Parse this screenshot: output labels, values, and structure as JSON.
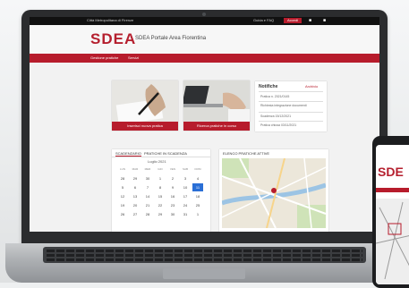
{
  "site": {
    "topbar_left": "Città Metropolitana di Firenze",
    "topbar_link": "Guida e FAQ",
    "topbar_button": "Accedi",
    "logo": "SDEA",
    "logo_subtitle": "SDEA Portale Area Fiorentina",
    "nav": [
      "Gestione pratiche",
      "Servizi"
    ]
  },
  "cards": [
    {
      "caption": "Inserisci nuova pratica"
    },
    {
      "caption": "Ricerca pratiche in corso"
    }
  ],
  "sidebar": {
    "title": "Notifiche",
    "badge": "Archivio",
    "items": [
      "Pratica n. 2021/0145",
      "Richiesta integrazione documenti",
      "Scadenza 15/12/2021",
      "Pratica chiusa 03/11/2021"
    ]
  },
  "calendar": {
    "tabs": [
      "SCADENZARIO",
      "PRATICHE IN SCADENZA"
    ],
    "month": "Luglio 2021",
    "weekdays": [
      "LUN",
      "MAR",
      "MER",
      "GIO",
      "VEN",
      "SAB",
      "DOM"
    ],
    "rows": [
      [
        "28",
        "29",
        "30",
        "1",
        "2",
        "3",
        "4"
      ],
      [
        "5",
        "6",
        "7",
        "8",
        "9",
        "10",
        "11"
      ],
      [
        "12",
        "13",
        "14",
        "15",
        "16",
        "17",
        "18"
      ],
      [
        "19",
        "20",
        "21",
        "22",
        "23",
        "24",
        "25"
      ],
      [
        "26",
        "27",
        "28",
        "29",
        "30",
        "31",
        "1"
      ]
    ],
    "selected": "11"
  },
  "map": {
    "title": "ELENCO PRATICHE ATTIVE"
  },
  "phone": {
    "logo": "SDE"
  },
  "colors": {
    "brand": "#b71c2c",
    "selected": "#2a6fd6"
  }
}
